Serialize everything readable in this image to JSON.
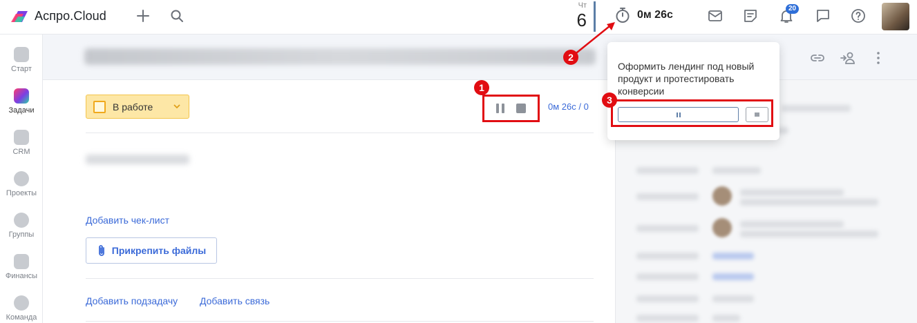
{
  "header": {
    "app_title": "Аспро.Cloud",
    "date_dow": "Чт",
    "date_day": "6",
    "timer_value": "0м 26с",
    "notifications_count": "20"
  },
  "sidebar": {
    "items": [
      {
        "label": "Старт",
        "icon": "home-icon"
      },
      {
        "label": "Задачи",
        "icon": "tasks-icon"
      },
      {
        "label": "CRM",
        "icon": "crm-icon"
      },
      {
        "label": "Проекты",
        "icon": "projects-icon"
      },
      {
        "label": "Группы",
        "icon": "groups-icon"
      },
      {
        "label": "Финансы",
        "icon": "finance-icon"
      },
      {
        "label": "Команда",
        "icon": "team-icon"
      }
    ]
  },
  "task": {
    "status_label": "В работе",
    "time_tracked": "0м 26с / 0",
    "add_checklist": "Добавить чек-лист",
    "attach_files": "Прикрепить файлы",
    "add_subtask": "Добавить подзадачу",
    "add_relation": "Добавить связь"
  },
  "timer_popover": {
    "task_title": "Оформить лендинг под новый продукт и протестировать конверсии"
  },
  "callouts": [
    "1",
    "2",
    "3"
  ],
  "colors": {
    "accent": "#3b6ad8",
    "annotation": "#e10d12",
    "status_bg": "#fde7a6"
  }
}
